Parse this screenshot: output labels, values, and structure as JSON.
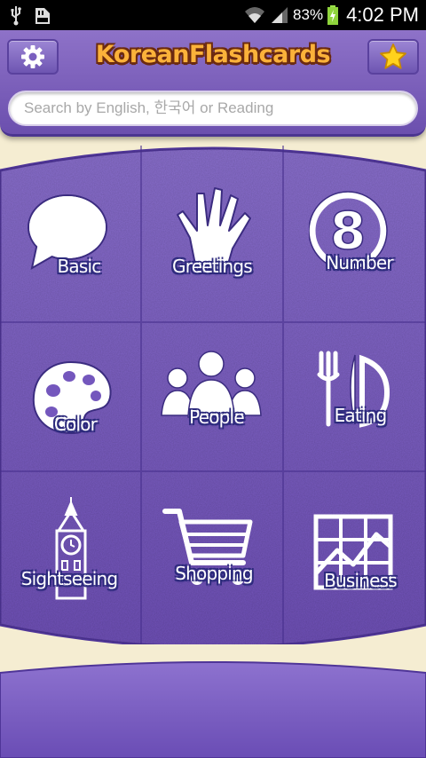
{
  "status_bar": {
    "battery_percent": "83%",
    "time": "4:02 PM",
    "icons": [
      "usb-icon",
      "sd-card-icon",
      "wifi-icon",
      "signal-icon",
      "battery-charging-icon"
    ]
  },
  "header": {
    "title": "KoreanFlashcards",
    "settings_icon": "gear-icon",
    "favorites_icon": "star-icon"
  },
  "search": {
    "placeholder": "Search by English, 한국어 or Reading",
    "value": ""
  },
  "categories": [
    {
      "label": "Basic",
      "icon": "speech-bubble-icon"
    },
    {
      "label": "Greetings",
      "icon": "waving-hand-icon"
    },
    {
      "label": "Number",
      "icon": "number-eight-icon"
    },
    {
      "label": "Color",
      "icon": "paint-palette-icon"
    },
    {
      "label": "People",
      "icon": "people-group-icon"
    },
    {
      "label": "Eating",
      "icon": "fork-knife-plate-icon"
    },
    {
      "label": "Sightseeing",
      "icon": "clock-tower-icon"
    },
    {
      "label": "Shopping",
      "icon": "shopping-cart-icon"
    },
    {
      "label": "Business",
      "icon": "business-chart-icon"
    }
  ],
  "colors": {
    "board_purple": "#7a5cc0",
    "title_orange": "#fbb23a",
    "background_cream": "#f5edd2"
  }
}
